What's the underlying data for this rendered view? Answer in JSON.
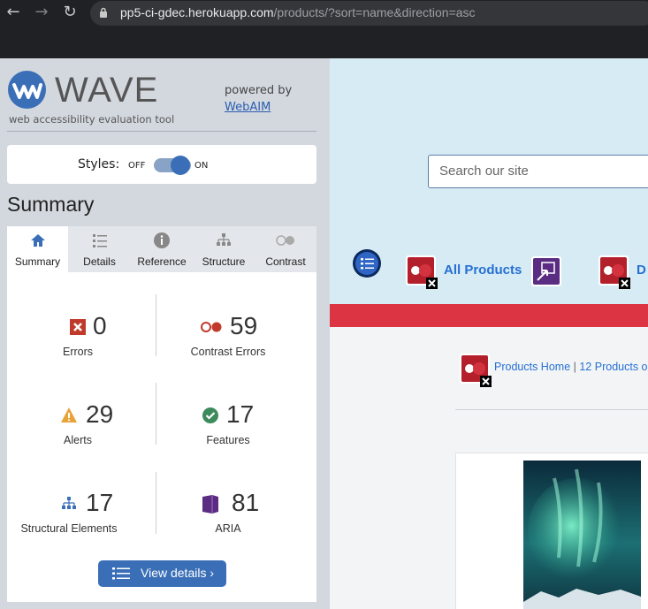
{
  "browser": {
    "url_host": "pp5-ci-gdec.herokuapp.com",
    "url_path": "/products/?sort=name&direction=asc"
  },
  "wave": {
    "logo_text": "WAVE",
    "tagline": "web accessibility evaluation tool",
    "powered_by": "powered by",
    "webaim_link": "WebAIM",
    "styles": {
      "label": "Styles:",
      "off": "OFF",
      "on": "ON",
      "state": "on"
    },
    "summary_title": "Summary",
    "tabs": [
      {
        "label": "Summary",
        "icon": "home-icon",
        "active": true
      },
      {
        "label": "Details",
        "icon": "list-icon",
        "active": false
      },
      {
        "label": "Reference",
        "icon": "info-icon",
        "active": false
      },
      {
        "label": "Structure",
        "icon": "hierarchy-icon",
        "active": false
      },
      {
        "label": "Contrast",
        "icon": "contrast-icon",
        "active": false
      }
    ],
    "stats": {
      "errors": {
        "count": "0",
        "label": "Errors",
        "icon": "error-icon",
        "color": "#c0392b"
      },
      "contrast_errors": {
        "count": "59",
        "label": "Contrast Errors",
        "icon": "contrast-error-icon",
        "color": "#c0392b"
      },
      "alerts": {
        "count": "29",
        "label": "Alerts",
        "icon": "alert-icon",
        "color": "#e8a33a"
      },
      "features": {
        "count": "17",
        "label": "Features",
        "icon": "feature-icon",
        "color": "#3d8a5c"
      },
      "structural": {
        "count": "17",
        "label": "Structural Elements",
        "icon": "structure-icon",
        "color": "#3a6fb7"
      },
      "aria": {
        "count": "81",
        "label": "ARIA",
        "icon": "aria-icon",
        "color": "#5a2d82"
      }
    },
    "view_details": "View details ›",
    "accent": "#3a6fb7"
  },
  "site": {
    "search_placeholder": "Search our site",
    "nav": {
      "all_products": "All Products",
      "truncated_next": "D"
    },
    "breadcrumb": {
      "home": "Products Home",
      "sep": " | ",
      "count": "12 Products o"
    },
    "accent_red": "#dd3444",
    "link_blue": "#2670d4"
  }
}
